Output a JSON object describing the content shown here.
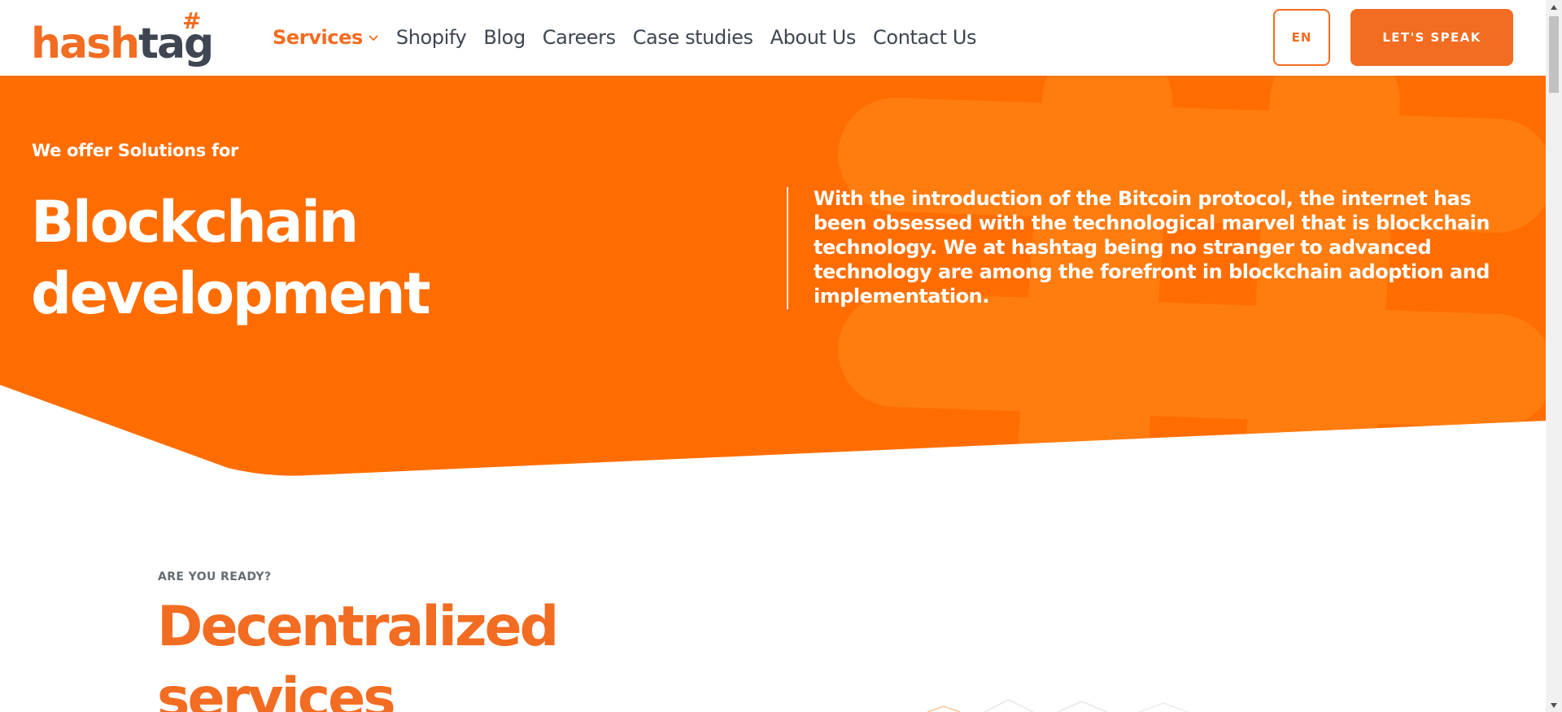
{
  "header": {
    "logo": {
      "text_a": "has",
      "text_b": "h",
      "text_c": "tag",
      "mark": "#"
    },
    "nav": [
      {
        "label": "Services",
        "active": true
      },
      {
        "label": "Shopify"
      },
      {
        "label": "Blog"
      },
      {
        "label": "Careers"
      },
      {
        "label": "Case studies"
      },
      {
        "label": "About Us"
      },
      {
        "label": "Contact Us"
      }
    ],
    "lang_label": "EN",
    "cta_label": "LET'S SPEAK"
  },
  "hero": {
    "eyebrow": "We offer Solutions for",
    "title": "Blockchain development",
    "description": "With the introduction of the Bitcoin protocol, the internet has been obsessed with the technological marvel that is blockchain technology. We at hashtag being no stranger to advanced technology are among the forefront in blockchain adoption and implementation."
  },
  "section": {
    "eyebrow": "ARE YOU READY?",
    "title": "Decentralized services"
  },
  "colors": {
    "accent": "#f26c21",
    "hero_bg": "#ff6d00",
    "text_dark": "#3d4651"
  },
  "icons": [
    "chevron-down-icon",
    "hash-watermark-icon",
    "scroll-up-icon",
    "scroll-down-icon"
  ]
}
